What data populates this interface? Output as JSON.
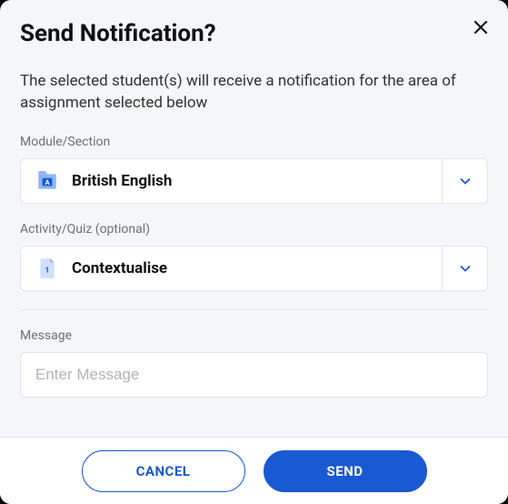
{
  "title": "Send Notification?",
  "description": "The selected student(s) will receive a notification for the area of assignment selected below",
  "module": {
    "label": "Module/Section",
    "value": "British English"
  },
  "activity": {
    "label": "Activity/Quiz (optional)",
    "value": "Contextualise"
  },
  "message": {
    "label": "Message",
    "placeholder": "Enter Message",
    "value": ""
  },
  "buttons": {
    "cancel": "CANCEL",
    "send": "SEND"
  }
}
